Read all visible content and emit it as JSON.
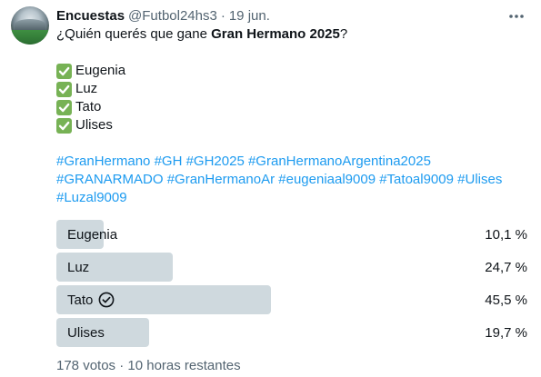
{
  "author": {
    "name": "Encuestas",
    "handle": "@Futbol24hs3",
    "separator": "·",
    "date": "19 jun."
  },
  "tweet": {
    "question_prefix": "¿Quién querés que gane ",
    "question_bold": "Gran Hermano 2025",
    "question_suffix": "?",
    "listed_options": [
      "Eugenia",
      "Luz",
      "Tato",
      "Ulises"
    ],
    "hashtag_lines": [
      [
        "#GranHermano",
        "#GH",
        "#GH2025",
        "#GranHermanoArgentina2025"
      ],
      [
        "#GRANARMADO",
        "#GranHermanoAr",
        "#eugeniaal9009",
        "#Tatoal9009",
        "#Ulises"
      ],
      [
        "#Luzal9009"
      ]
    ]
  },
  "poll": {
    "options": [
      {
        "label": "Eugenia",
        "percent_text": "10,1 %",
        "percent": 10.1,
        "winner": false
      },
      {
        "label": "Luz",
        "percent_text": "24,7 %",
        "percent": 24.7,
        "winner": false
      },
      {
        "label": "Tato",
        "percent_text": "45,5 %",
        "percent": 45.5,
        "winner": true
      },
      {
        "label": "Ulises",
        "percent_text": "19,7 %",
        "percent": 19.7,
        "winner": false
      }
    ],
    "votes": "178 votos",
    "separator": "·",
    "time_left": "10 horas restantes"
  },
  "colors": {
    "text": "#0f1419",
    "secondary": "#536471",
    "link": "#1d9bf0",
    "poll_bar": "#cfd9de",
    "check_emoji": "#77b255"
  },
  "icons": {
    "more": "more-horizontal-icon",
    "check_emoji": "check-mark-button-icon",
    "winner": "circle-check-icon"
  }
}
